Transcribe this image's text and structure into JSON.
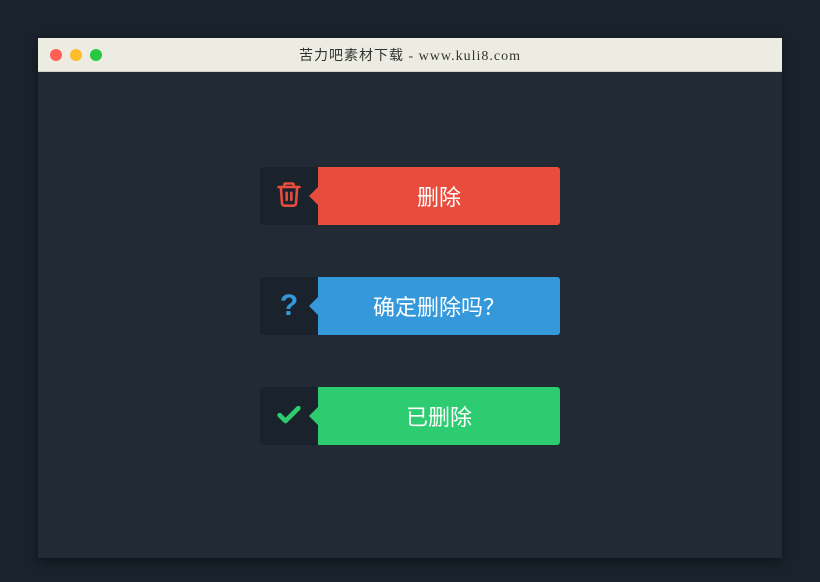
{
  "window": {
    "title": "苦力吧素材下载 - www.kuli8.com"
  },
  "buttons": [
    {
      "label": "删除",
      "icon": "trash",
      "color": "#e74c3c"
    },
    {
      "label": "确定删除吗？",
      "icon": "question",
      "color": "#3498db"
    },
    {
      "label": "已删除",
      "icon": "check",
      "color": "#2ecc71"
    }
  ],
  "colors": {
    "page_bg": "#1a222c",
    "window_bg": "#222b35",
    "titlebar_bg": "#ecece3",
    "red": "#e74c3c",
    "blue": "#3498db",
    "green": "#2ecc71"
  }
}
